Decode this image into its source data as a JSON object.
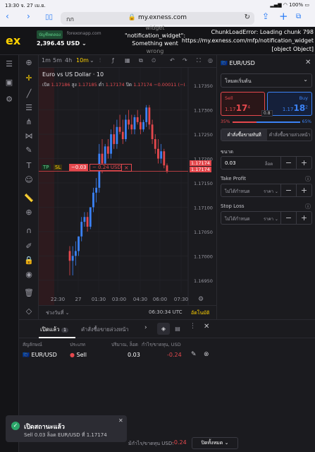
{
  "status_bar": {
    "time": "13:30",
    "date": "จ. 27 เม.ย.",
    "battery": "100%"
  },
  "browser": {
    "aa_label": "กก",
    "host": "my.exness.com"
  },
  "header": {
    "account_type": "บัญชีทดลอง",
    "server": "forexonapp.com",
    "balance": "2,396.45 USD",
    "error_left_line1": "widget",
    "error_left_line2": "\"notification_widget\":",
    "error_left_line3": "Something went",
    "error_left_line4": "wrong",
    "error_right_line1": "ChunkLoadError: Loading chunk 798",
    "error_right_line2": "https://my.exness.com/mfp/notification_widget",
    "error_right_line3": "[object Object]"
  },
  "chart_toolbar": {
    "timeframes": [
      "1m",
      "5m",
      "4h",
      "10m"
    ]
  },
  "chart_data": {
    "type": "candlestick",
    "title": "Euro vs US Dollar · 10",
    "ohlc_labels": {
      "open_label": "เปิด",
      "open": "1.17186",
      "high_label": "สูง",
      "high": "1.17185",
      "low_label": "ต่ำ",
      "low": "1.17174",
      "close_label": "ปิด",
      "close": "1.17174",
      "change": "−0.00011 (−I"
    },
    "y_ticks": [
      "1.17350",
      "1.17300",
      "1.17250",
      "1.17200",
      "1.17150",
      "1.17100",
      "1.17050",
      "1.17000",
      "1.16950"
    ],
    "x_ticks": [
      "22:30",
      "27",
      "01:30",
      "03:00",
      "04:30",
      "06:00",
      "07:30"
    ],
    "price_labels": [
      "1.17174",
      "1.17174"
    ],
    "candles": [
      [
        1.1701,
        1.1702,
        1.1696,
        1.1699
      ],
      [
        1.1699,
        1.1702,
        1.1696,
        1.17
      ],
      [
        1.17,
        1.1703,
        1.1698,
        1.1701
      ],
      [
        1.1701,
        1.1704,
        1.17,
        1.1704
      ],
      [
        1.1704,
        1.1708,
        1.1703,
        1.1707
      ],
      [
        1.1707,
        1.1709,
        1.1706,
        1.1708
      ],
      [
        1.1708,
        1.1709,
        1.1705,
        1.1706
      ],
      [
        1.1706,
        1.171,
        1.17055,
        1.171
      ],
      [
        1.171,
        1.1714,
        1.1709,
        1.1713
      ],
      [
        1.1713,
        1.1716,
        1.1711,
        1.1714
      ],
      [
        1.1714,
        1.1723,
        1.1713,
        1.1721
      ],
      [
        1.1721,
        1.1724,
        1.1717,
        1.1719
      ],
      [
        1.1719,
        1.1723,
        1.1718,
        1.17225
      ],
      [
        1.17225,
        1.1724,
        1.172,
        1.1721
      ],
      [
        1.1721,
        1.1726,
        1.172,
        1.1725
      ],
      [
        1.1725,
        1.1727,
        1.1722,
        1.1723
      ],
      [
        1.1723,
        1.1728,
        1.1722,
        1.17265
      ],
      [
        1.17265,
        1.1729,
        1.1725,
        1.17255
      ],
      [
        1.17255,
        1.1728,
        1.1723,
        1.1724
      ],
      [
        1.1724,
        1.1729,
        1.17235,
        1.1728
      ],
      [
        1.1728,
        1.173,
        1.1726,
        1.1727
      ],
      [
        1.1727,
        1.1729,
        1.1725,
        1.1726
      ],
      [
        1.1726,
        1.1729,
        1.1725,
        1.17285
      ],
      [
        1.17285,
        1.173,
        1.1727,
        1.17275
      ],
      [
        1.17275,
        1.1729,
        1.1725,
        1.1726
      ],
      [
        1.1726,
        1.1728,
        1.17255,
        1.17275
      ],
      [
        1.17275,
        1.1731,
        1.17265,
        1.17305
      ],
      [
        1.17305,
        1.1731,
        1.1726,
        1.1727
      ],
      [
        1.1727,
        1.1728,
        1.1723,
        1.1724
      ],
      [
        1.1724,
        1.1725,
        1.1721,
        1.1722
      ],
      [
        1.1722,
        1.1724,
        1.1719,
        1.172
      ],
      [
        1.172,
        1.1723,
        1.1719,
        1.17215
      ],
      [
        1.17215,
        1.1722,
        1.1718,
        1.17186
      ],
      [
        1.17186,
        1.1719,
        1.1717,
        1.17174
      ]
    ],
    "ylim": [
      1.16925,
      1.17375
    ],
    "trade_line": {
      "price": 1.17174,
      "tp": "TP",
      "sl": "SL",
      "volume": "−0.03",
      "pnl": "− 0.24 USD",
      "close": "×"
    }
  },
  "chart_footer": {
    "range": "ช่วงวันที่",
    "time": "06:30:34 UTC",
    "auto": "อัตโนมัติ"
  },
  "panel": {
    "symbol": "EUR/USD",
    "mode": "โหมดเริ่มต้น",
    "sell_label": "Sell",
    "sell_price_main": "1.17",
    "sell_price_big": "17",
    "sell_price_sup": "4",
    "buy_label": "Buy",
    "buy_price_main": "1.17",
    "buy_price_big": "18",
    "buy_price_sup": "2",
    "spread": "0.8",
    "sell_pct": "35%",
    "buy_pct": "65%",
    "tab_market": "คำสั่งซื้อขายทันที",
    "tab_pending": "คำสั่งซื้อขายล่วงหน้า",
    "volume_label": "ขนาด",
    "volume_value": "0.03",
    "volume_unit": "ล็อต",
    "tp_label": "Take Profit",
    "tp_value": "ไม่ได้กำหนด",
    "tp_unit": "ราคา",
    "sl_label": "Stop Loss",
    "sl_value": "ไม่ได้กำหนด",
    "sl_unit": "ราคา"
  },
  "positions": {
    "tab_open": "เปิดแล้ว",
    "tab_open_count": "1",
    "tab_pending": "คำสั่งซื้อขายล่วงหน้า",
    "col_symbol": "สัญลักษณ์",
    "col_type": "ประเภท",
    "col_volume": "ปริมาณ, ล็อต",
    "col_pnl": "กำไร/ขาดทุน, USD",
    "rows": [
      {
        "symbol": "EUR/USD",
        "type": "Sell",
        "volume": "0.03",
        "pnl": "-0.24"
      }
    ],
    "total_label": "ม้กำไร/ขาดทุน USD:",
    "total_value": "-0.24",
    "close_all": "ปิดทั้งหมด"
  },
  "toast": {
    "title": "เปิดสถานะแล้ว",
    "message": "Sell 0.03 ล็อต EUR/USD ที่ 1.17174"
  },
  "colors": {
    "sell": "#e5484d",
    "buy": "#3b82f6",
    "up": "#3b82f6",
    "accent": "#ffd200"
  }
}
